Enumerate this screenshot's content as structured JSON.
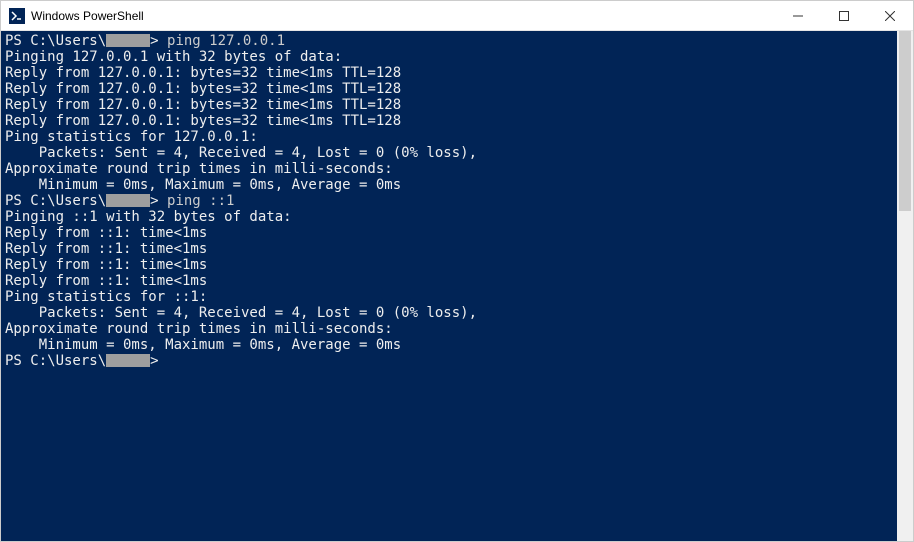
{
  "window": {
    "title": "Windows PowerShell",
    "icon_name": "powershell-icon"
  },
  "controls": {
    "min": "minimize",
    "max": "maximize",
    "close": "close"
  },
  "terminal": {
    "prompt_prefix": "PS C:\\Users\\",
    "prompt_suffix": "> ",
    "redacted_user": "[redacted]",
    "blocks": [
      {
        "command": "ping 127.0.0.1",
        "lines": [
          "Pinging 127.0.0.1 with 32 bytes of data:",
          "Reply from 127.0.0.1: bytes=32 time<1ms TTL=128",
          "Reply from 127.0.0.1: bytes=32 time<1ms TTL=128",
          "Reply from 127.0.0.1: bytes=32 time<1ms TTL=128",
          "Reply from 127.0.0.1: bytes=32 time<1ms TTL=128",
          "",
          "Ping statistics for 127.0.0.1:",
          "    Packets: Sent = 4, Received = 4, Lost = 0 (0% loss),",
          "Approximate round trip times in milli-seconds:",
          "    Minimum = 0ms, Maximum = 0ms, Average = 0ms"
        ]
      },
      {
        "command": "ping ::1",
        "lines": [
          "Pinging ::1 with 32 bytes of data:",
          "Reply from ::1: time<1ms",
          "Reply from ::1: time<1ms",
          "Reply from ::1: time<1ms",
          "Reply from ::1: time<1ms",
          "",
          "Ping statistics for ::1:",
          "    Packets: Sent = 4, Received = 4, Lost = 0 (0% loss),",
          "Approximate round trip times in milli-seconds:",
          "    Minimum = 0ms, Maximum = 0ms, Average = 0ms"
        ]
      }
    ],
    "final_prompt": true
  }
}
